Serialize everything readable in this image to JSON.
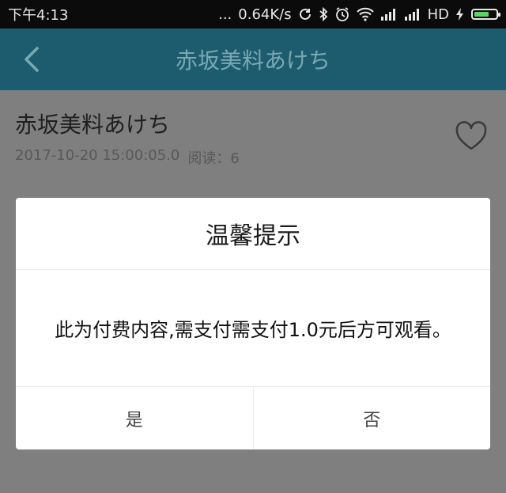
{
  "status_bar": {
    "time": "下午4:13",
    "dots": "...",
    "network_speed": "0.64K/s",
    "network_type": "HD"
  },
  "app_bar": {
    "title": "赤坂美料あけち"
  },
  "article": {
    "title": "赤坂美料あけち",
    "date": "2017-10-20 15:00:05.0",
    "read_label": "阅读：6"
  },
  "dialog": {
    "title": "温馨提示",
    "message": "此为付费内容,需支付需支付1.0元后方可观看。",
    "yes_label": "是",
    "no_label": "否"
  },
  "icons": {
    "back": "chevron-left-icon",
    "favorite": "heart-icon"
  },
  "colors": {
    "app_bar": "#1d5c6e",
    "overlay": "#7f7f7f",
    "battery": "#5fd35f"
  }
}
